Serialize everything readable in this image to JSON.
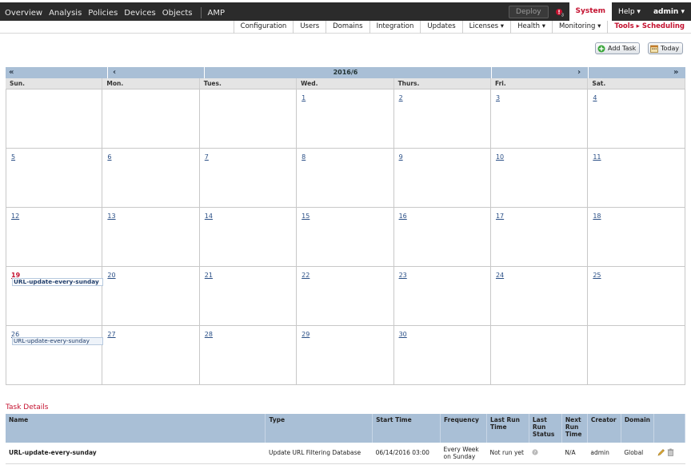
{
  "top_nav": {
    "menu": [
      "Overview",
      "Analysis",
      "Policies",
      "Devices",
      "Objects",
      "AMP"
    ],
    "deploy_label": "Deploy",
    "system_label": "System",
    "help_label": "Help ▾",
    "admin_label": "admin ▾"
  },
  "sub_nav": {
    "items": [
      "Configuration",
      "Users",
      "Domains",
      "Integration",
      "Updates",
      "Licenses ▾",
      "Health ▾",
      "Monitoring ▾",
      "Tools ▸ Scheduling"
    ]
  },
  "actions": {
    "add_task": "Add Task",
    "today": "Today"
  },
  "calendar": {
    "month_label": "2016/6",
    "nav_prev_year": "«",
    "nav_prev_month": "‹",
    "nav_next_month": "›",
    "nav_next_year": "»",
    "weekdays": [
      "Sun.",
      "Mon.",
      "Tues.",
      "Wed.",
      "Thurs.",
      "Fri.",
      "Sat."
    ],
    "weeks": [
      [
        "",
        "",
        "",
        "1",
        "2",
        "3",
        "4"
      ],
      [
        "5",
        "6",
        "7",
        "8",
        "9",
        "10",
        "11"
      ],
      [
        "12",
        "13",
        "14",
        "15",
        "16",
        "17",
        "18"
      ],
      [
        "19",
        "20",
        "21",
        "22",
        "23",
        "24",
        "25"
      ],
      [
        "26",
        "27",
        "28",
        "29",
        "30",
        "",
        ""
      ]
    ],
    "today": "19",
    "events": [
      {
        "day": "19",
        "label": "URL-update-every-sunday"
      },
      {
        "day": "26",
        "label": "URL-update-every-sunday"
      }
    ]
  },
  "task_details": {
    "title": "Task Details",
    "columns": [
      "Name",
      "Type",
      "Start Time",
      "Frequency",
      "Last Run Time",
      "Last Run Status",
      "Next Run Time",
      "Creator",
      "Domain"
    ],
    "rows": [
      {
        "name": "URL-update-every-sunday",
        "type": "Update URL Filtering Database",
        "start_time": "06/14/2016 03:00",
        "frequency": "Every Week on Sunday",
        "last_run_time": "Not run yet",
        "last_run_status_icon": "unknown-status-icon",
        "next_run_time": "N/A",
        "creator": "admin",
        "domain": "Global"
      }
    ]
  },
  "colors": {
    "accent_red": "#c41230",
    "nav_dark": "#2b2b2b",
    "header_blue": "#a9bfd6",
    "link_blue": "#2a4f86"
  }
}
